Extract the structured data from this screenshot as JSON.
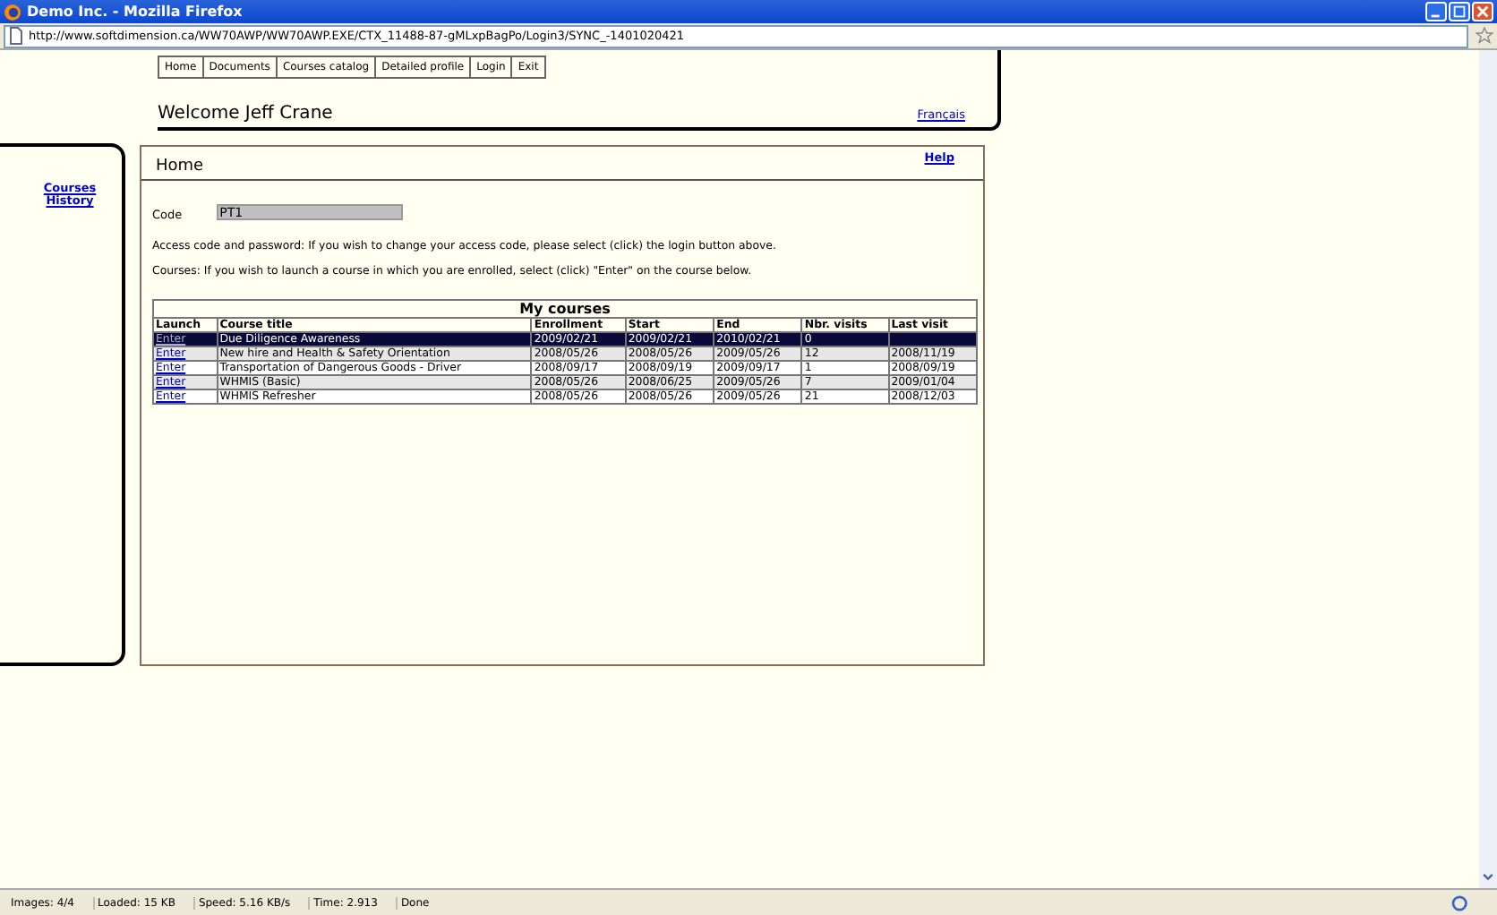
{
  "window": {
    "title": "Demo Inc. - Mozilla Firefox"
  },
  "address_bar": {
    "url": "http://www.softdimension.ca/WW70AWP/WW70AWP.EXE/CTX_11488-87-gMLxpBagPo/Login3/SYNC_-1401020421"
  },
  "nav": [
    "Home",
    "Documents",
    "Courses catalog",
    "Detailed profile",
    "Login",
    "Exit"
  ],
  "welcome": "Welcome Jeff Crane",
  "language_link": "Français",
  "sidebar": {
    "links": [
      "Courses",
      "History"
    ]
  },
  "panel": {
    "title": "Home",
    "help": "Help"
  },
  "code": {
    "label": "Code",
    "value": "PT1"
  },
  "notes": [
    "Access code and password: If you wish to change your access code, please select (click) the login button above.",
    "Courses: If you wish to launch a course in which you are enrolled, select (click) \"Enter\" on the course below."
  ],
  "table": {
    "caption": "My courses",
    "columns": [
      "Launch",
      "Course title",
      "Enrollment",
      "Start",
      "End",
      "Nbr. visits",
      "Last visit"
    ],
    "rows": [
      {
        "selected": true,
        "cells": [
          "Enter",
          "Due Diligence Awareness",
          "2009/02/21",
          "2009/02/21",
          "2010/02/21",
          "0",
          ""
        ]
      },
      {
        "selected": false,
        "cells": [
          "Enter",
          "New hire and Health & Safety Orientation",
          "2008/05/26",
          "2008/05/26",
          "2009/05/26",
          "12",
          "2008/11/19"
        ]
      },
      {
        "selected": false,
        "cells": [
          "Enter",
          "Transportation of Dangerous Goods - Driver",
          "2008/09/17",
          "2008/09/19",
          "2009/09/17",
          "1",
          "2008/09/19"
        ]
      },
      {
        "selected": false,
        "cells": [
          "Enter",
          "WHMIS (Basic)",
          "2008/05/26",
          "2008/06/25",
          "2009/05/26",
          "7",
          "2009/01/04"
        ]
      },
      {
        "selected": false,
        "cells": [
          "Enter",
          "WHMIS Refresher",
          "2008/05/26",
          "2008/05/26",
          "2009/05/26",
          "21",
          "2008/12/03"
        ]
      }
    ]
  },
  "status_bar": [
    "Images: 4/4",
    "Loaded: 15 KB",
    "Speed: 5.16 KB/s",
    "Time: 2.913",
    "Done"
  ]
}
